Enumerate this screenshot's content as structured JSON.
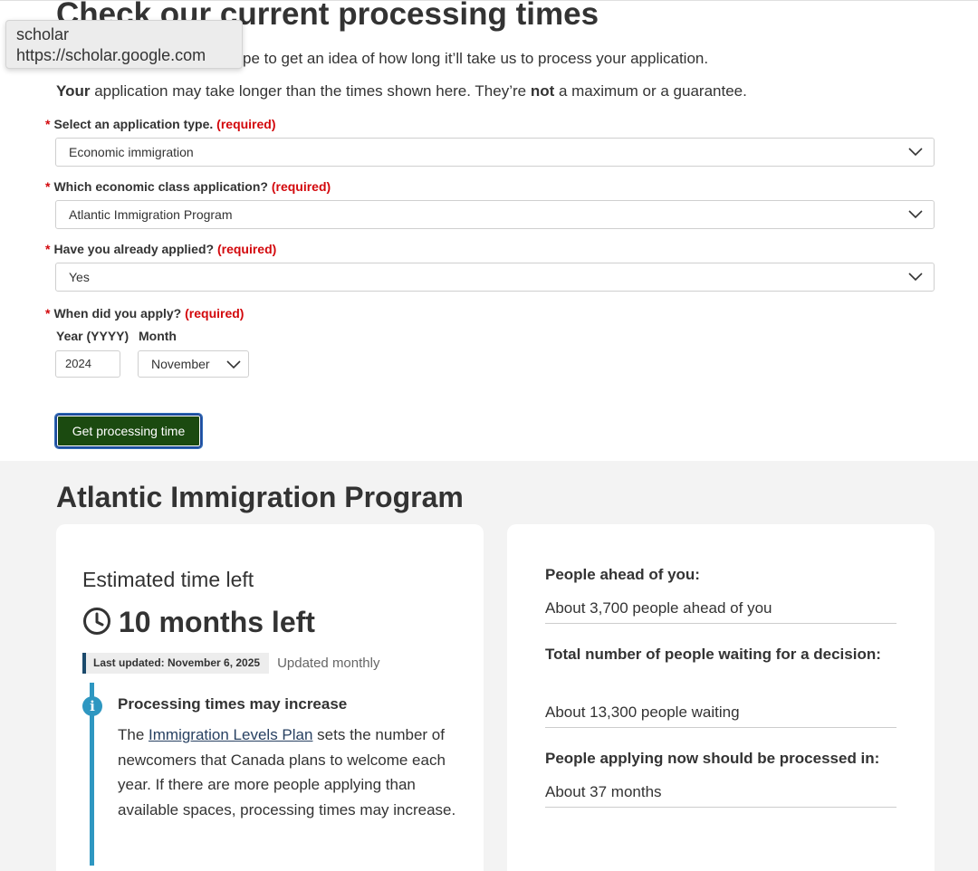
{
  "page": {
    "title": "Check our current processing times",
    "intro_visible": "pe to get an idea of how long it’ll take us to process your application.",
    "note": {
      "bold1": "Your",
      "part1": " application may take longer than the times shown here. They’re ",
      "bold2": "not",
      "part2": " a maximum or a guarantee."
    }
  },
  "tooltip": {
    "title": "scholar",
    "url": "https://scholar.google.com"
  },
  "form": {
    "required_marker": "*",
    "application_type": {
      "label": "Select an application type.",
      "required": "(required)",
      "value": "Economic immigration"
    },
    "economic_class": {
      "label": "Which economic class application?",
      "required": "(required)",
      "value": "Atlantic Immigration Program"
    },
    "already_applied": {
      "label": "Have you already applied?",
      "required": "(required)",
      "value": "Yes"
    },
    "when_applied": {
      "label": "When did you apply?",
      "required": "(required)",
      "year_label": "Year (YYYY)",
      "month_label": "Month",
      "year_value": "2024",
      "month_value": "November"
    },
    "submit_label": "Get processing time"
  },
  "result": {
    "program": "Atlantic Immigration Program",
    "estimate": {
      "label": "Estimated time left",
      "value": "10 months left",
      "last_updated": "Last updated: November 6, 2025",
      "frequency": "Updated monthly"
    },
    "notice": {
      "title": "Processing times may increase",
      "pre": "The ",
      "link": "Immigration Levels Plan",
      "post": " sets the number of newcomers that Canada plans to welcome each year. If there are more people applying than available spaces, processing times may increase."
    },
    "stats": {
      "ahead_label": "People ahead of you:",
      "ahead_value": "About 3,700 people ahead of you",
      "waiting_label": "Total number of people waiting for a decision:",
      "waiting_value": "About 13,300 people waiting",
      "new_label": "People applying now should be processed in:",
      "new_value": "About 37 months"
    }
  },
  "colors": {
    "required_red": "#d3080c",
    "button_green": "#1b4a10",
    "info_blue": "#2e97c1",
    "result_background": "#f3f3f3"
  },
  "icons": [
    "chevron-down-icon",
    "clock-icon",
    "info-icon"
  ]
}
